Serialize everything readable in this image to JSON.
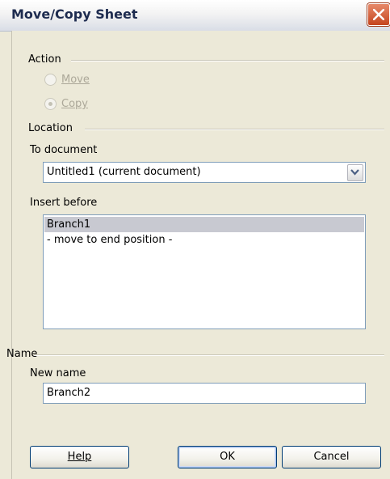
{
  "window": {
    "title": "Move/Copy Sheet",
    "close_icon": "close-icon",
    "accent_color": "#d1502a"
  },
  "action": {
    "group_label": "Action",
    "move_label": "Move",
    "copy_label": "Copy",
    "selected": "Copy",
    "enabled": false
  },
  "location": {
    "group_label": "Location",
    "to_document_label": "To document",
    "to_document_value": "Untitled1 (current document)",
    "insert_before_label": "Insert before",
    "insert_before_items": [
      "Branch1",
      "- move to end position -"
    ],
    "insert_before_selected": "Branch1"
  },
  "name": {
    "group_label": "Name",
    "new_name_label": "New name",
    "new_name_value": "Branch2"
  },
  "buttons": {
    "help": "Help",
    "ok": "OK",
    "cancel": "Cancel"
  }
}
